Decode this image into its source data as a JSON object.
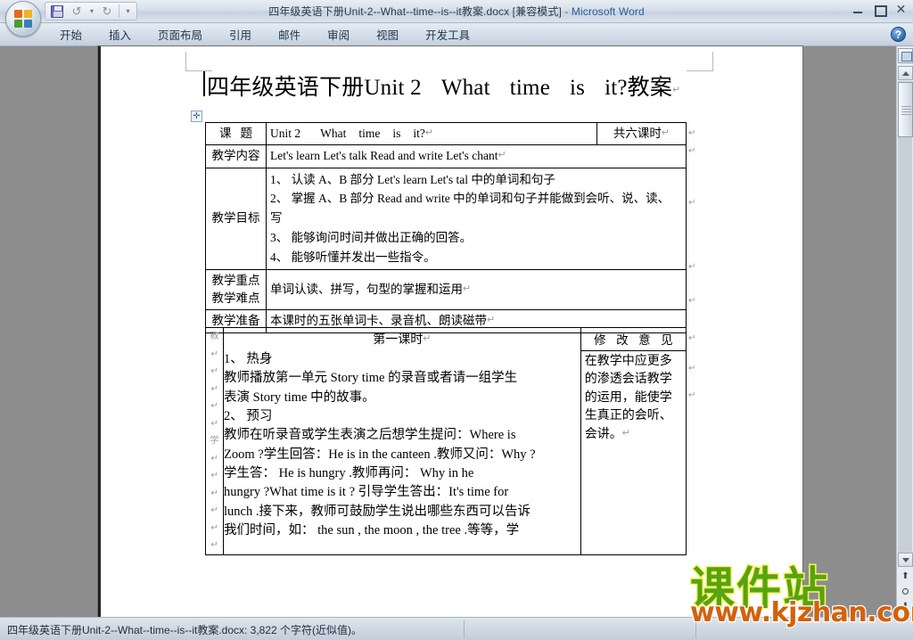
{
  "window": {
    "title_doc": "四年级英语下册Unit-2--What--time--is--it教案.docx [兼容模式]",
    "title_sep": " - ",
    "app_name": "Microsoft Word",
    "minimize_label": "最小化",
    "restore_label": "还原",
    "close_label": "✕",
    "help_label": "?"
  },
  "quick_access": {
    "save_label": "保存",
    "undo_label": "↺",
    "undo_caret": "▾",
    "redo_label": "↻",
    "customize_caret": "▾"
  },
  "ribbon": {
    "tabs": [
      {
        "label": "开始"
      },
      {
        "label": "插入"
      },
      {
        "label": "页面布局"
      },
      {
        "label": "引用"
      },
      {
        "label": "邮件"
      },
      {
        "label": "审阅"
      },
      {
        "label": "视图"
      },
      {
        "label": "开发工具"
      }
    ]
  },
  "document": {
    "title_cn1": "四年级英语下册",
    "title_en": "Unit 2",
    "title_en2": "What",
    "title_en3": "time",
    "title_en4": "is",
    "title_en5": "it?",
    "title_cn2": "教案",
    "pilcrow": "↵",
    "table_handle_icon": "✛",
    "info_table": {
      "rows": [
        {
          "label": "课    题",
          "value_en": "Unit 2",
          "value_en2": "What",
          "value_en3": "time",
          "value_en4": "is",
          "value_en5": "it?",
          "hours": "共六课时"
        },
        {
          "label": "教学内容",
          "value": "Let's learn     Let's talk     Read and write   Let's chant"
        }
      ],
      "goals_label": "教学目标",
      "goals": [
        "1、 认读 A、B 部分 Let's learn Let's tal 中的单词和句子",
        "2、 掌握 A、B 部分 Read and write 中的单词和句子并能做到会听、说、读、",
        "写",
        "3、 能够询问时间并做出正确的回答。",
        "4、 能够听懂并发出一些指令。"
      ],
      "focus_label_1": "教学重点",
      "focus_label_2": "教学难点",
      "focus_value": "单词认读、拼写，句型的掌握和运用",
      "prep_label": "教学准备",
      "prep_value": "本课时的五张单词卡、录音机、朗读磁带"
    },
    "body_table": {
      "gutter_top": "教",
      "gutter_mid": "学",
      "period_title": "第一课时",
      "lines": [
        "1、 热身",
        "教师播放第一单元 Story time 的录音或者请一组学生",
        "表演 Story time 中的故事。",
        "2、 预习",
        "教师在听录音或学生表演之后想学生提问：Where  is",
        "Zoom ?学生回答：He is in the canteen .教师又问：Why ?",
        "学生答： He  is  hungry .教师再问：  Why  in  he",
        "hungry ?What  time  is  it ? 引导学生答出：It's  time  for",
        "lunch .接下来，教师可鼓励学生说出哪些东西可以告诉",
        "我们时间，如： the sun , the moon , the tree .等等，学"
      ],
      "note_head": "修 改 意 见",
      "note_lines": [
        "在教学中应更多",
        "的渗透会话教学",
        "的运用，能使学",
        "生真正的会听、",
        "会讲。"
      ]
    }
  },
  "watermark": {
    "brand_cn": "课件站",
    "brand_url": "www.kjzhan.com"
  },
  "statusbar": {
    "text": "四年级英语下册Unit-2--What--time--is--it教案.docx: 3,822 个字符(近似值)。"
  },
  "scrollbar": {
    "select_browse_object": "选择浏览对象",
    "prev_page": "⬆",
    "browse_dot": "○",
    "next_page": "⬇",
    "up_label": "向上",
    "down_label": "向下"
  }
}
